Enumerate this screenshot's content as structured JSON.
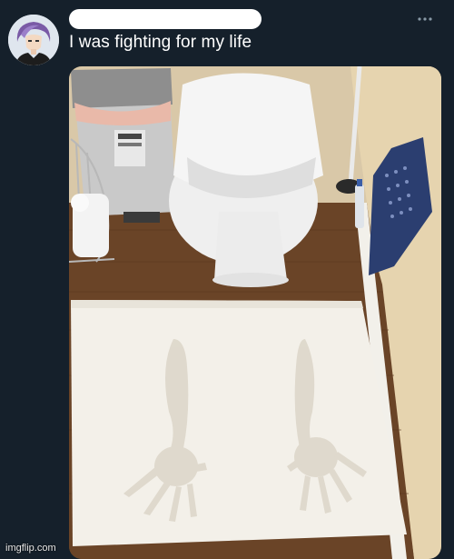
{
  "tweet": {
    "text": "I was fighting for my life",
    "more_icon": "more-horizontal-icon",
    "avatar_icon": "anime-avatar"
  },
  "watermark": {
    "text": "imgflip.com"
  },
  "colors": {
    "background": "#15202b",
    "text": "#ffffff",
    "redaction": "#ffffff"
  }
}
